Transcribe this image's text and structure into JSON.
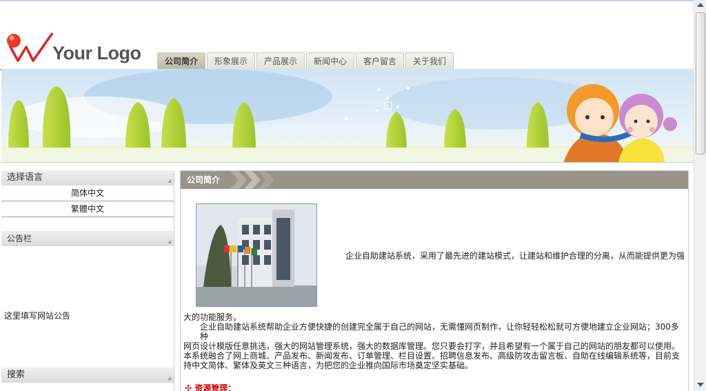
{
  "logo": {
    "text": "Your Logo"
  },
  "nav": {
    "tabs": [
      {
        "label": "公司简介"
      },
      {
        "label": "形象展示"
      },
      {
        "label": "产品展示"
      },
      {
        "label": "新闻中心"
      },
      {
        "label": "客户留言"
      },
      {
        "label": "关于我们"
      }
    ]
  },
  "sidebar": {
    "language_title": "选择语言",
    "languages": [
      "简体中文",
      "繁體中文"
    ],
    "notice_title": "公告栏",
    "notice_text": "这里填写网站公告",
    "search_title": "搜索"
  },
  "main": {
    "title": "公司简介",
    "intro_line": "企业自助建站系统，采用了最先进的建站模式，让建站和维护合理的分离，从而能提供更为强",
    "intro_cont": "大的功能服务。",
    "para_line1": "企业自助建站系统帮助企业方便快捷的创建完全属于自己的网站，无需懂网页制作，让你轻轻松松就可方便地建立企业网站；300多种",
    "para_line2": "网页设计模版任意挑选，强大的网站管理系统，强大的数据库管理。您只要会打字，并且希望有一个属于自己的网站的朋友都可以使用。",
    "para_line3": "本系统融合了网上商城、产品发布、新闻发布、订单管理、栏目设置、招聘信息发布、高级防攻击留言板、自助在线编辑系统等，目前支",
    "para_line4": "持中文简体、繁体及英文三种语言，为把您的企业推向国际市场奠定坚实基础。",
    "section_title": "资源管理："
  },
  "colors": {
    "header_bar": "#9a938a",
    "accent_red": "#cc0000",
    "scroll_arrow": "#2a5db0"
  }
}
